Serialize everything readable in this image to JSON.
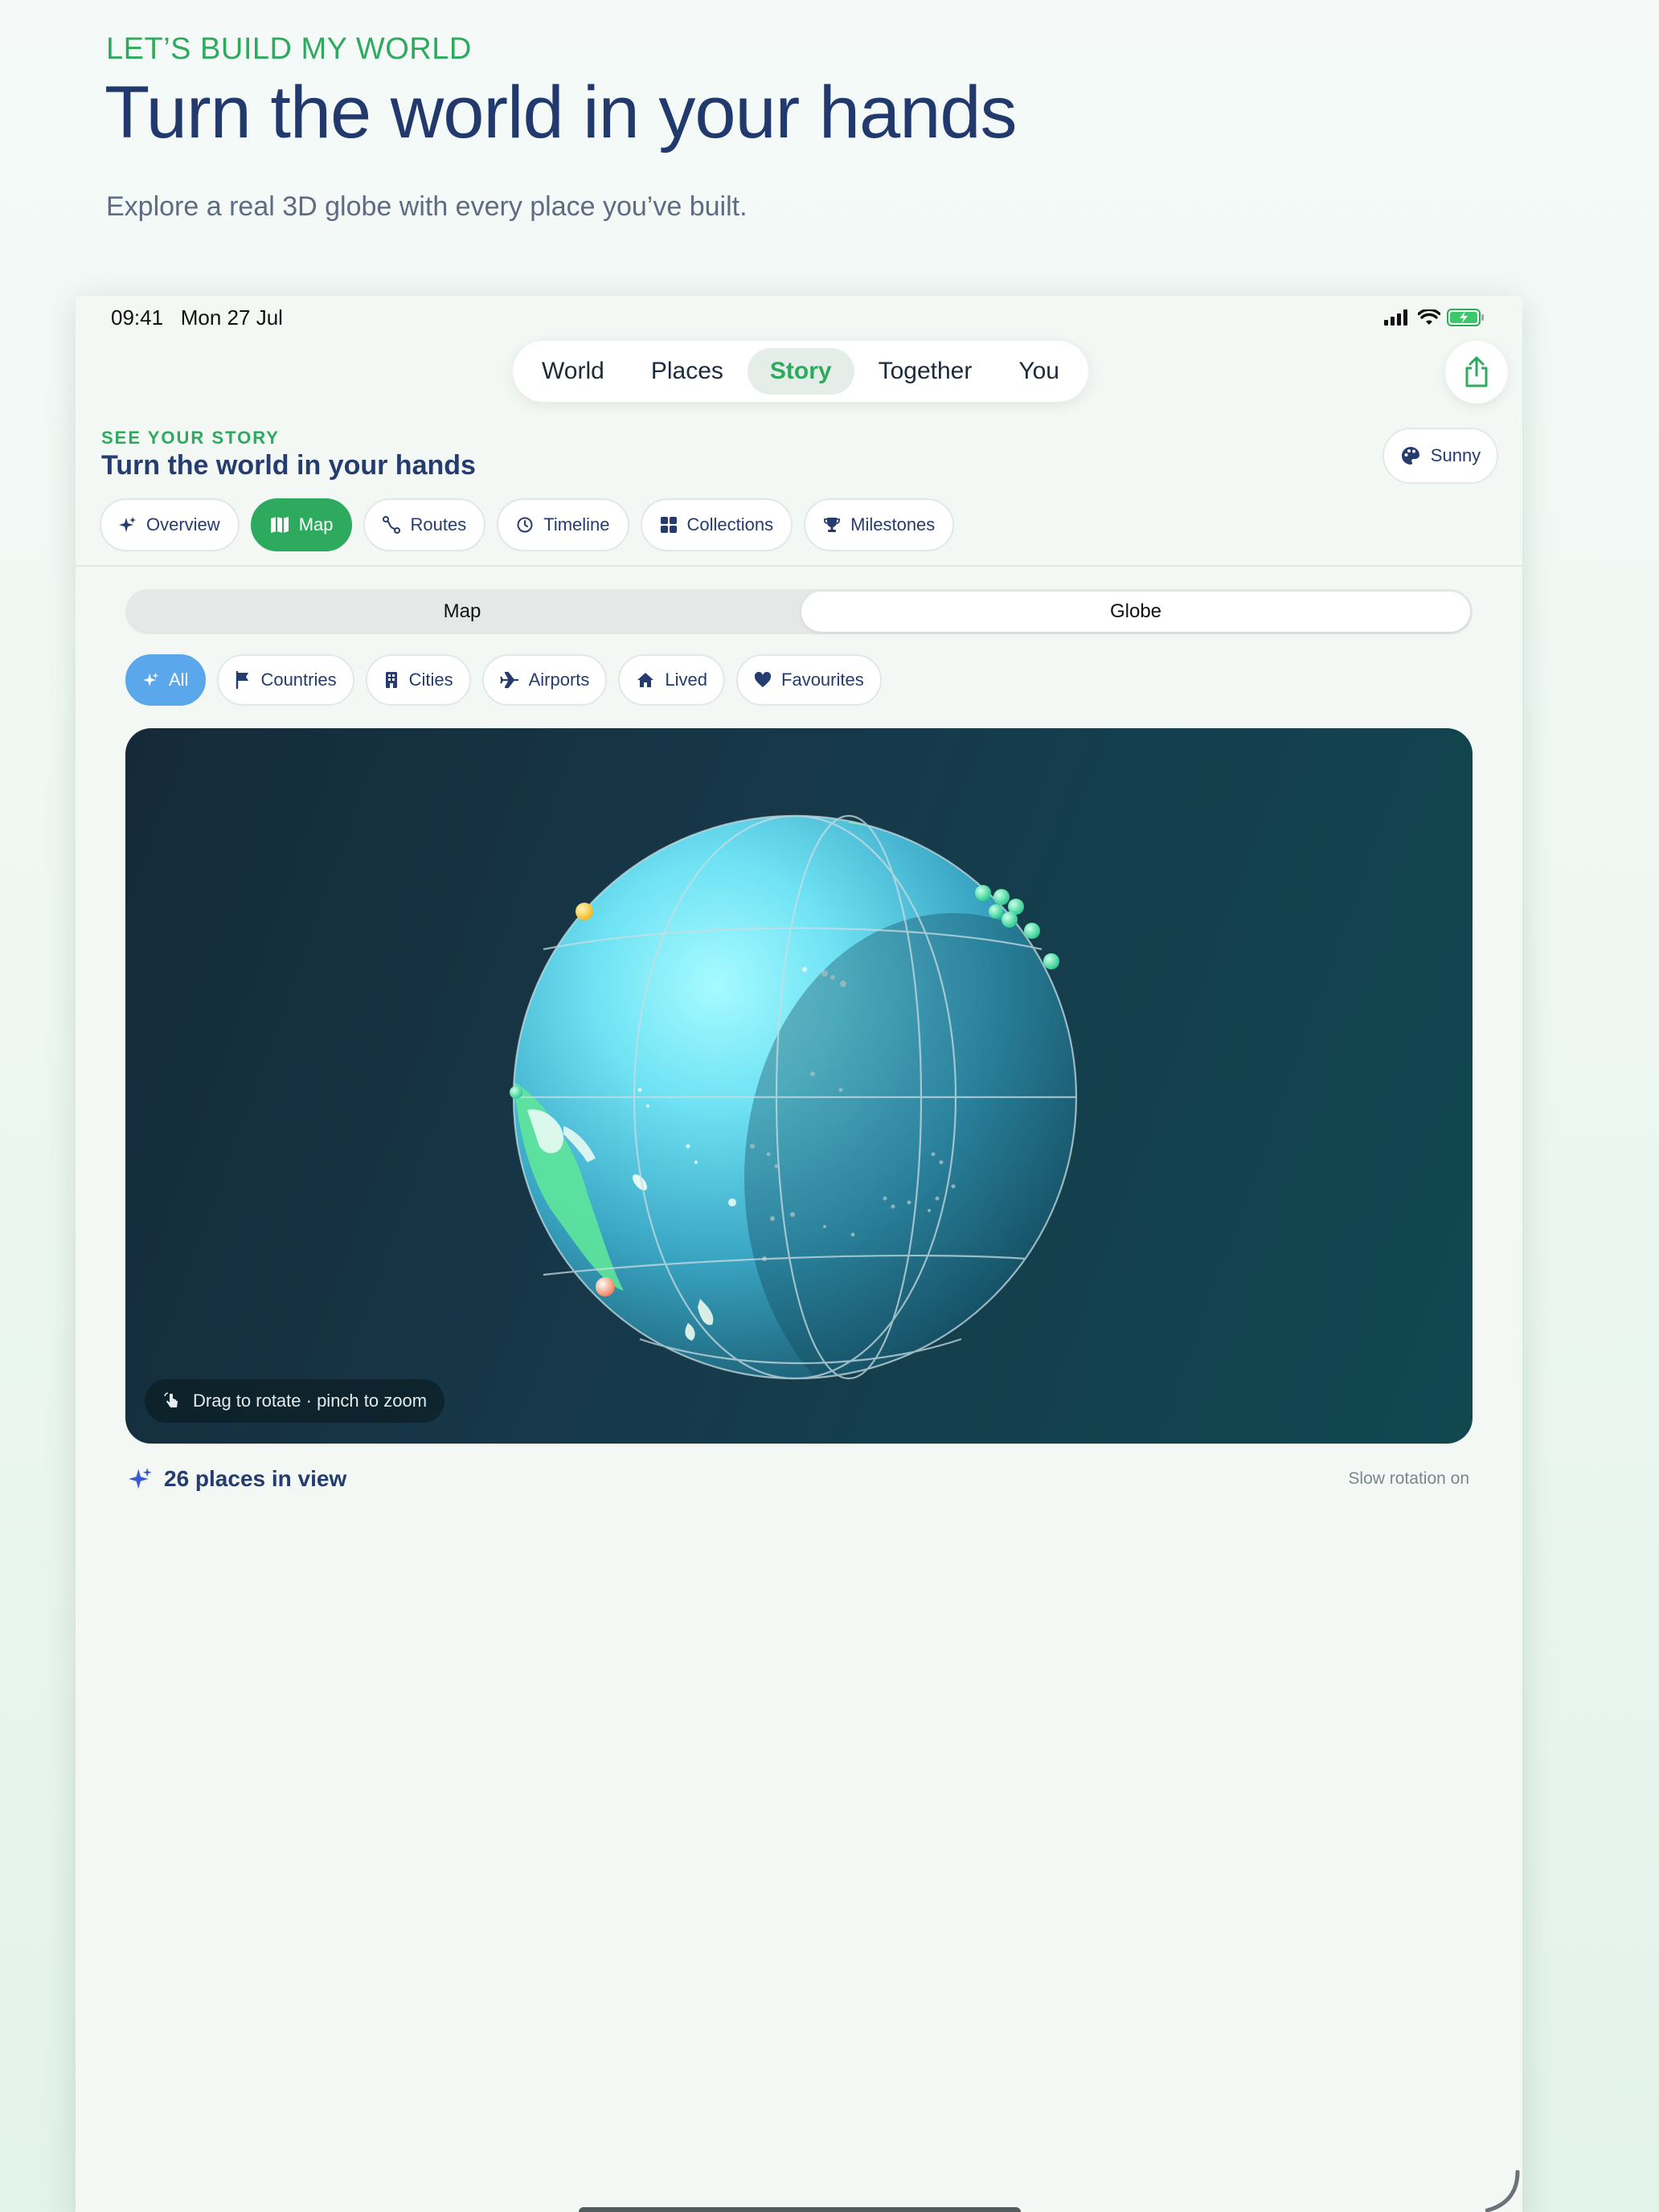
{
  "hero": {
    "eyebrow": "LET’S BUILD MY WORLD",
    "title": "Turn the world in your hands",
    "subtitle": "Explore a real 3D globe with every place you’ve built."
  },
  "status_bar": {
    "time": "09:41",
    "date": "Mon 27 Jul",
    "icons": [
      "signal-icon",
      "wifi-icon",
      "battery-charging-icon"
    ]
  },
  "tabs": [
    {
      "label": "World",
      "active": false
    },
    {
      "label": "Places",
      "active": false
    },
    {
      "label": "Story",
      "active": true
    },
    {
      "label": "Together",
      "active": false
    },
    {
      "label": "You",
      "active": false
    }
  ],
  "section": {
    "eyebrow": "SEE YOUR STORY",
    "title": "Turn the world in your hands",
    "theme_label": "Sunny"
  },
  "subtabs": [
    {
      "label": "Overview",
      "icon": "sparkle-icon",
      "active": false
    },
    {
      "label": "Map",
      "icon": "map-icon",
      "active": true
    },
    {
      "label": "Routes",
      "icon": "route-icon",
      "active": false
    },
    {
      "label": "Timeline",
      "icon": "history-icon",
      "active": false
    },
    {
      "label": "Collections",
      "icon": "grid-icon",
      "active": false
    },
    {
      "label": "Milestones",
      "icon": "trophy-icon",
      "active": false
    }
  ],
  "view_mode": {
    "options": [
      "Map",
      "Globe"
    ],
    "selected": "Globe"
  },
  "filters": [
    {
      "label": "All",
      "icon": "sparkle-icon",
      "active": true
    },
    {
      "label": "Countries",
      "icon": "flag-icon",
      "active": false
    },
    {
      "label": "Cities",
      "icon": "building-icon",
      "active": false
    },
    {
      "label": "Airports",
      "icon": "airplane-icon",
      "active": false
    },
    {
      "label": "Lived",
      "icon": "home-icon",
      "active": false
    },
    {
      "label": "Favourites",
      "icon": "heart-icon",
      "active": false
    }
  ],
  "globe": {
    "hint": "Drag to rotate · pinch to zoom",
    "places_label": "26 places in view",
    "rotation_note": "Slow rotation on"
  },
  "colors": {
    "accent_green": "#2eaa5e",
    "navy": "#22396e",
    "filter_blue": "#5ba7ec",
    "card_dark": "#152a38"
  }
}
